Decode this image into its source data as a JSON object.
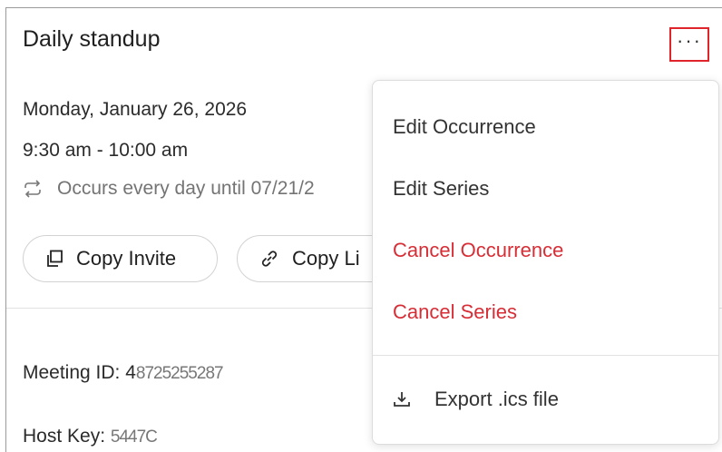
{
  "meeting": {
    "title": "Daily standup",
    "more_label": "···",
    "date": "Monday, January 26, 2026",
    "time": "9:30 am - 10:00 am",
    "recurrence": "Occurs every day until 07/21/2",
    "copy_invite": "Copy Invite",
    "copy_link": "Copy Li",
    "meeting_id_label": "Meeting ID: 4",
    "meeting_id_value": "8725255287",
    "host_key_label": "Host Key:",
    "host_key_value": "5447C"
  },
  "menu": {
    "edit_occurrence": "Edit Occurrence",
    "edit_series": "Edit Series",
    "cancel_occurrence": "Cancel Occurrence",
    "cancel_series": "Cancel Series",
    "export": "Export .ics file"
  },
  "colors": {
    "danger": "#d72e36",
    "highlight": "#e0242b"
  }
}
